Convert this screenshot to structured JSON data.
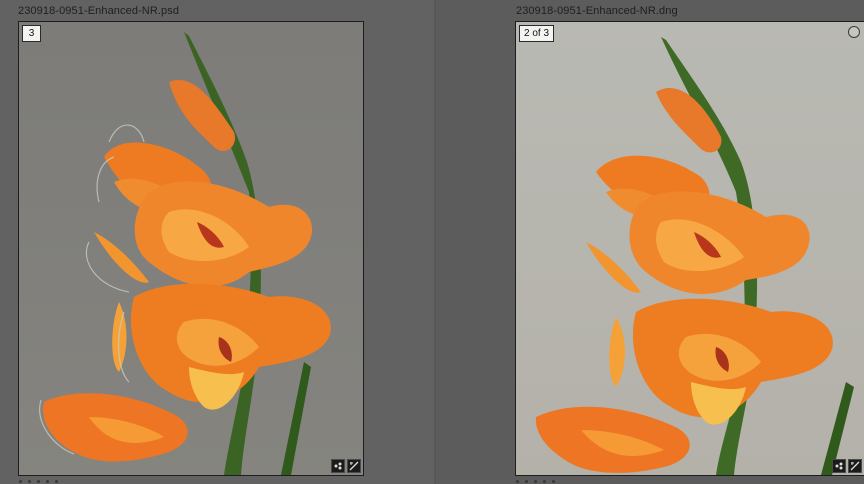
{
  "left": {
    "filename": "230918-0951-Enhanced-NR.psd",
    "badge": "3"
  },
  "right": {
    "filename": "230918-0951-Enhanced-NR.dng",
    "badge": "2 of 3"
  },
  "icons": {
    "flag": "flag-icon",
    "develop": "develop-settings-icon",
    "crop": "crop-icon",
    "select": "selection-circle-icon"
  },
  "colors": {
    "background": "#5f5f5f",
    "petal": "#ec7a25",
    "petal_light": "#f6a741",
    "stem": "#3f6a26"
  }
}
